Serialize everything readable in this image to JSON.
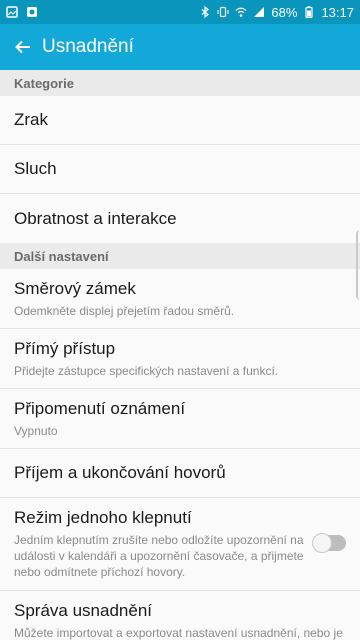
{
  "status_bar": {
    "battery": "68%",
    "time": "13:17"
  },
  "app_bar": {
    "title": "Usnadnění"
  },
  "sections": [
    {
      "header": "Kategorie"
    },
    {
      "header": "Další nastavení"
    }
  ],
  "categories": [
    "Zrak",
    "Sluch",
    "Obratnost a interakce"
  ],
  "more": {
    "swipe_lock": {
      "title": "Směrový zámek",
      "sub": "Odemkněte displej přejetím řadou směrů."
    },
    "direct_access": {
      "title": "Přímý přístup",
      "sub": "Přidejte zástupce specifických nastavení a funkcí."
    },
    "notification_reminder": {
      "title": "Připomenutí oznámení",
      "sub": "Vypnuto"
    },
    "call_answering": {
      "title": "Příjem a ukončování hovorů"
    },
    "single_tap": {
      "title": "Režim jednoho klepnutí",
      "sub": "Jedním klepnutím zrušíte nebo odložíte upozornění na události v kalendáři a upozornění časovače, a přijmete nebo odmítnete příchozí hovory.",
      "toggle_on": false
    },
    "manage": {
      "title": "Správa usnadnění",
      "sub": "Můžete importovat a exportovat nastavení usnadnění, nebo je"
    }
  }
}
